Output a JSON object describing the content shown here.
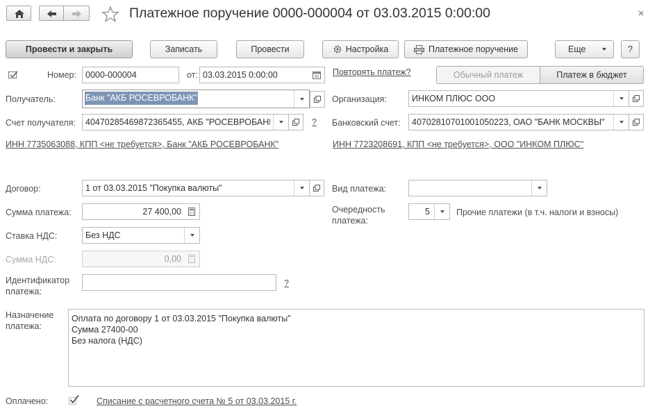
{
  "window": {
    "title": "Платежное поручение 0000-000004 от 03.03.2015 0:00:00"
  },
  "toolbar": {
    "post_close": "Провести и закрыть",
    "save": "Записать",
    "post": "Провести",
    "settings": "Настройка",
    "print": "Платежное поручение",
    "more": "Еще",
    "help": "?"
  },
  "header": {
    "number_label": "Номер:",
    "number_value": "0000-000004",
    "date_label": "от:",
    "date_value": "03.03.2015  0:00:00",
    "repeat_link": "Повторять платеж?",
    "mode_regular": "Обычный платеж",
    "mode_budget": "Платеж в бюджет"
  },
  "recipient": {
    "label": "Получатель:",
    "value": "Банк \"АКБ РОСЕВРОБАНК\"",
    "account_label": "Счет получателя:",
    "account_value": "40470285469872365455, АКБ \"РОСЕВРОБАНК\"",
    "help": "?",
    "inn_link": "ИНН 7735063088, КПП <не требуется>, Банк \"АКБ РОСЕВРОБАНК\""
  },
  "organization": {
    "label": "Организация:",
    "value": "ИНКОМ ПЛЮС ООО",
    "bank_account_label": "Банковский счет:",
    "bank_account_value": "40702810701001050223, ОАО \"БАНК МОСКВЫ\"",
    "inn_link": "ИНН 7723208691, КПП <не требуется>, ООО \"ИНКОМ ПЛЮС\""
  },
  "contract": {
    "label": "Договор:",
    "value": "1 от 03.03.2015 \"Покупка валюты\""
  },
  "payment_type": {
    "label": "Вид платежа:",
    "value": ""
  },
  "amount": {
    "label": "Сумма платежа:",
    "value": "27 400,00"
  },
  "priority": {
    "label_line1": "Очередность",
    "label_line2": "платежа:",
    "value": "5",
    "description": "Прочие платежи (в т.ч. налоги и взносы)"
  },
  "vat_rate": {
    "label": "Ставка НДС:",
    "value": "Без НДС"
  },
  "vat_amount": {
    "label": "Сумма НДС:",
    "value": "0,00"
  },
  "payment_id": {
    "label_line1": "Идентификатор",
    "label_line2": "платежа:",
    "value": "",
    "help": "?"
  },
  "purpose": {
    "label_line1": "Назначение",
    "label_line2": "платежа:",
    "lines": [
      "Оплата по договору 1 от 03.03.2015 \"Покупка валюты\"",
      "Сумма 27400-00",
      "Без налога (НДС)"
    ]
  },
  "paid": {
    "label": "Оплачено:",
    "checked": true,
    "link": "Списание с расчетного счета № 5 от 03.03.2015 г."
  },
  "colors": {
    "accent_selection": "#6f8db3",
    "link_text": "#4d4d4d",
    "primary_button": "#d6d6d6"
  }
}
